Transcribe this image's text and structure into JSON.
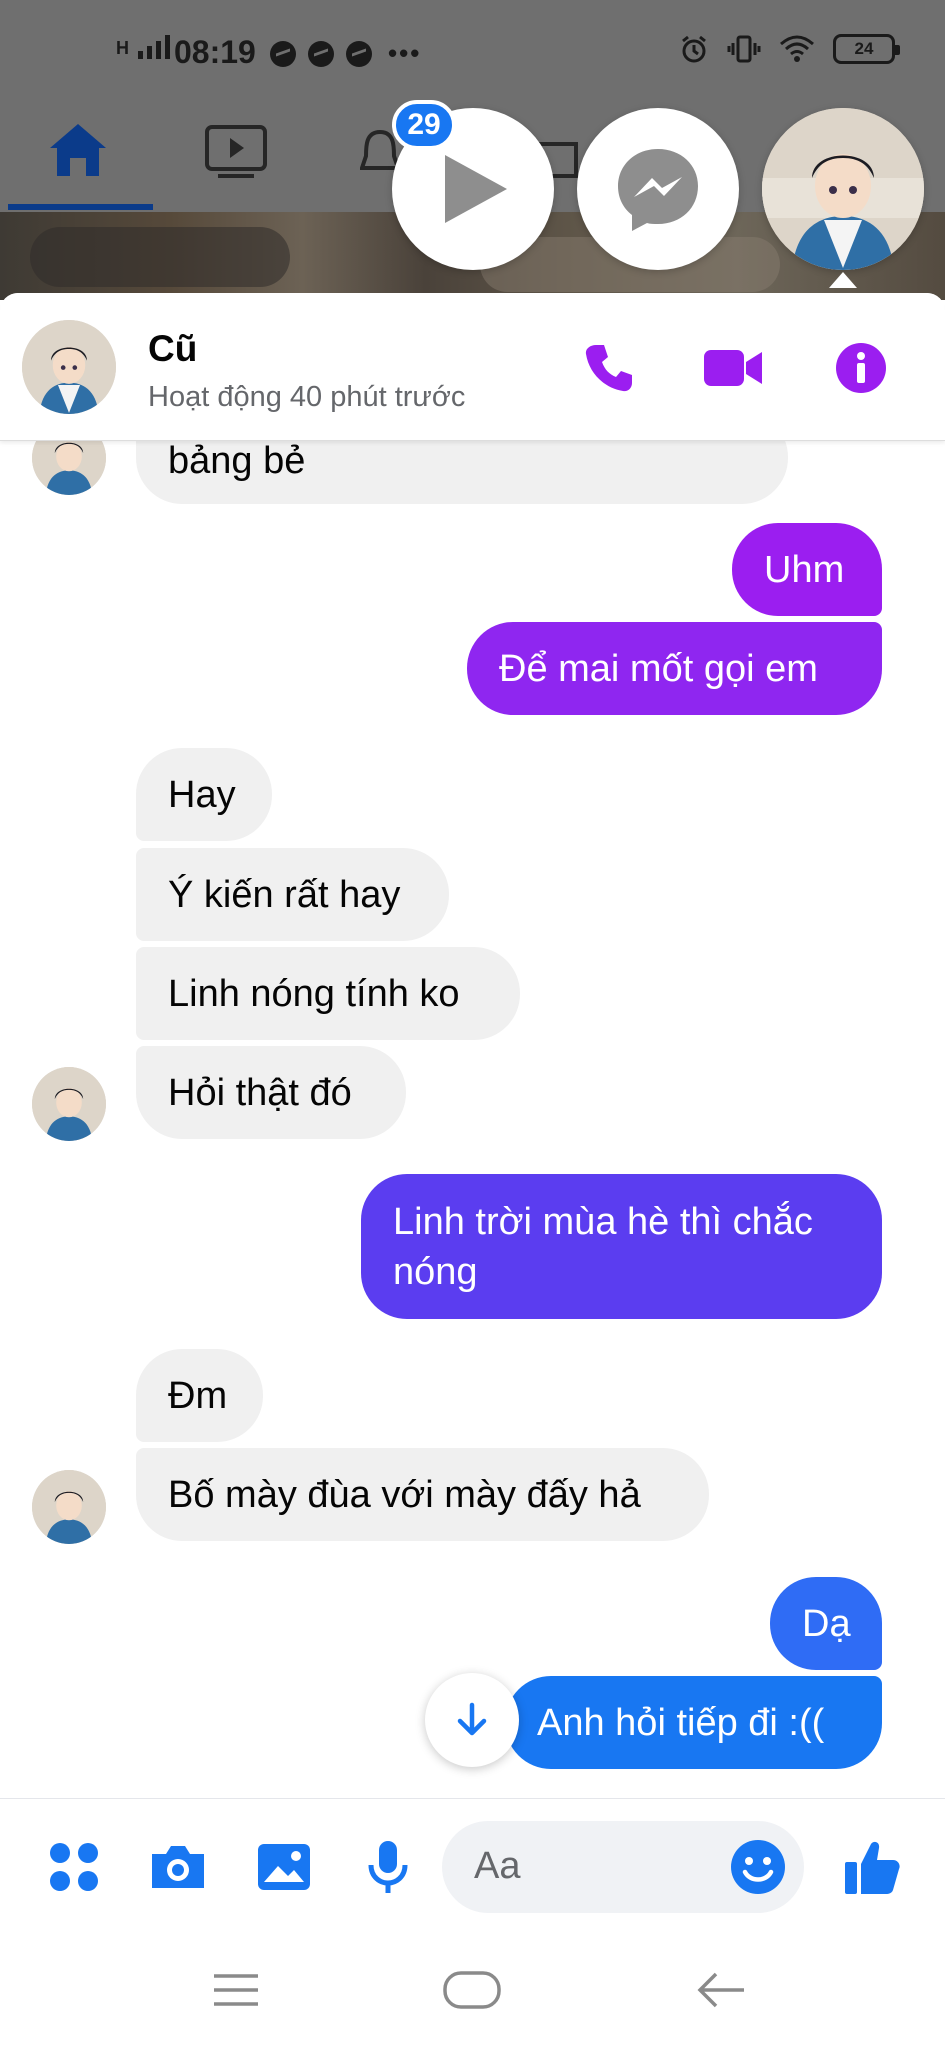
{
  "status_bar": {
    "network": "H",
    "time": "08:19",
    "more": "•••",
    "battery": "24"
  },
  "chat_heads": {
    "badge_count": "29"
  },
  "header": {
    "name": "Cũ",
    "status": "Hoạt động 40 phút trước"
  },
  "messages": [
    {
      "from": "them",
      "text": "bảng bẻ"
    },
    {
      "from": "me",
      "text": "Uhm"
    },
    {
      "from": "me",
      "text": "Để mai mốt gọi em"
    },
    {
      "from": "them",
      "text": "Hay"
    },
    {
      "from": "them",
      "text": "Ý kiến rất hay"
    },
    {
      "from": "them",
      "text": "Linh nóng tính ko"
    },
    {
      "from": "them",
      "text": "Hỏi thật đó"
    },
    {
      "from": "me",
      "text": "Linh trời mùa hè thì chắc nóng"
    },
    {
      "from": "them",
      "text": "Đm"
    },
    {
      "from": "them",
      "text": "Bố mày đùa với mày đấy hả"
    },
    {
      "from": "me",
      "text": "Dạ"
    },
    {
      "from": "me",
      "text": "Anh hỏi tiếp đi :(("
    }
  ],
  "composer": {
    "placeholder": "Aa"
  },
  "colors": {
    "accent_purple": "#9b1ef0",
    "messenger_blue": "#1877f2",
    "incoming_bubble": "#f0f0f0"
  },
  "icons": {
    "status": [
      "signal-icon",
      "messenger-notification-icon",
      "alarm-icon",
      "vibrate-icon",
      "wifi-icon",
      "battery-icon"
    ],
    "nav": [
      "home-icon",
      "watch-icon"
    ],
    "header": [
      "phone-icon",
      "video-call-icon",
      "info-icon"
    ],
    "composer": [
      "menu-dots-icon",
      "camera-icon",
      "image-icon",
      "microphone-icon",
      "emoji-icon",
      "thumbs-up-icon"
    ],
    "system": [
      "recents-icon",
      "home-button-icon",
      "back-icon"
    ]
  }
}
